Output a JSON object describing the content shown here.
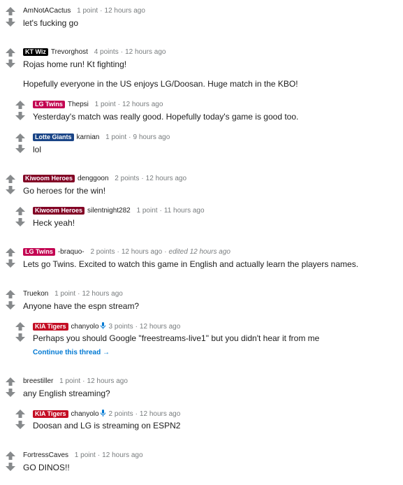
{
  "colors": {
    "flair_lg_twins": "#c30452",
    "flair_kiwoom": "#820024",
    "flair_lotte": "#1a4587",
    "flair_kia": "#c40d23",
    "flair_ktwiz": "#000000",
    "link": "#0079d3"
  },
  "icons": {
    "upvote": "arrow-up-icon",
    "downvote": "arrow-down-icon",
    "mic": "microphone-icon"
  },
  "comments": [
    {
      "user": "AmNotACactus",
      "points": "1 point",
      "time": "12 hours ago",
      "lines": [
        "let's fucking go"
      ]
    },
    {
      "flair": "KT Wiz",
      "user": "Trevorghost",
      "points": "4 points",
      "time": "12 hours ago",
      "lines": [
        "Rojas home run! Kt fighting!",
        "Hopefully everyone in the US enjoys LG/Doosan. Huge match in the KBO!"
      ]
    },
    {
      "flair": "LG Twins",
      "user": "Thepsi",
      "points": "1 point",
      "time": "12 hours ago",
      "lines": [
        "Yesterday's match was really good. Hopefully today's game is good too."
      ]
    },
    {
      "flair": "Lotte Giants",
      "user": "karnian",
      "points": "1 point",
      "time": "9 hours ago",
      "lines": [
        "lol"
      ]
    },
    {
      "flair": "Kiwoom Heroes",
      "user": "denggoon",
      "points": "2 points",
      "time": "12 hours ago",
      "lines": [
        "Go heroes for the win!"
      ]
    },
    {
      "flair": "Kiwoom Heroes",
      "user": "silentnight282",
      "points": "1 point",
      "time": "11 hours ago",
      "lines": [
        "Heck yeah!"
      ]
    },
    {
      "flair": "LG Twins",
      "user": "-braquo-",
      "points": "2 points",
      "time": "12 hours ago",
      "edited": "edited 12 hours ago",
      "lines": [
        "Lets go Twins. Excited to watch this game in English and actually learn the players names."
      ]
    },
    {
      "user": "Truekon",
      "points": "1 point",
      "time": "12 hours ago",
      "lines": [
        "Anyone have the espn stream?"
      ]
    },
    {
      "flair": "KIA Tigers",
      "user": "chanyolo",
      "points": "3 points",
      "time": "12 hours ago",
      "lines": [
        "Perhaps you should Google \"freestreams-live1\" but you didn't hear it from me"
      ],
      "continue": "Continue this thread →"
    },
    {
      "user": "breestiller",
      "points": "1 point",
      "time": "12 hours ago",
      "lines": [
        "any English streaming?"
      ]
    },
    {
      "flair": "KIA Tigers",
      "user": "chanyolo",
      "points": "2 points",
      "time": "12 hours ago",
      "lines": [
        "Doosan and LG is streaming on ESPN2"
      ]
    },
    {
      "user": "FortressCaves",
      "points": "1 point",
      "time": "12 hours ago",
      "lines": [
        "GO DINOS!!"
      ]
    }
  ]
}
